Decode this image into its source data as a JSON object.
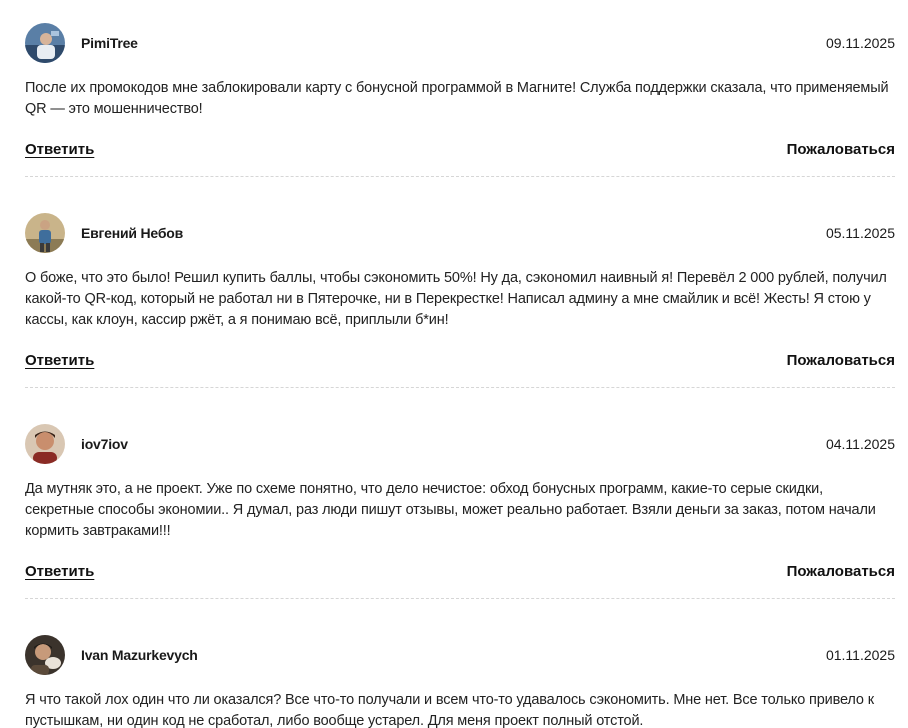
{
  "labels": {
    "reply": "Ответить",
    "report": "Пожаловаться"
  },
  "comments": [
    {
      "author": "PimiTree",
      "date": "09.11.2025",
      "text": "После их промокодов мне заблокировали карту с бонусной программой в Магните! Служба поддержки сказала, что применяемый QR — это мошенничество!"
    },
    {
      "author": "Евгений Небов",
      "date": "05.11.2025",
      "text": "О боже, что это было! Решил купить баллы, чтобы сэкономить 50%! Ну да, сэкономил наивный я! Перевёл 2 000 рублей, получил какой-то QR-код, который не работал ни в Пятерочке, ни в Перекрестке! Написал админу а мне смайлик и всё! Жесть! Я стою у кассы, как клоун, кассир ржёт, а я понимаю всё, приплыли б*ин!"
    },
    {
      "author": "iov7iov",
      "date": "04.11.2025",
      "text": "Да мутняк это, а не проект. Уже по схеме понятно, что дело нечистое: обход бонусных программ, какие-то серые скидки, секретные способы экономии.. Я думал, раз люди пишут отзывы, может реально работает. Взяли деньги за заказ, потом начали кормить завтраками!!!"
    },
    {
      "author": "Ivan Mazurkevych",
      "date": "01.11.2025",
      "text": "Я что такой лох один что ли оказался? Все что-то получали и всем что-то удавалось сэкономить. Мне нет. Все только привело к пустышкам, ни один код не сработал, либо вообще устарел. Для меня проект полный отстой."
    }
  ]
}
